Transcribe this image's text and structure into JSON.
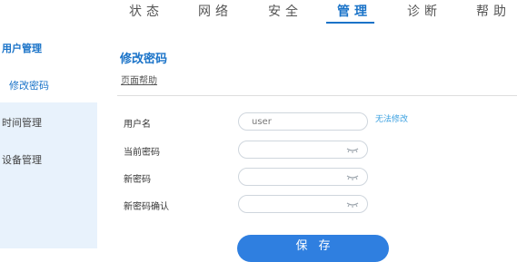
{
  "nav": {
    "tabs": [
      {
        "label": "状态"
      },
      {
        "label": "网络"
      },
      {
        "label": "安全"
      },
      {
        "label": "管理",
        "active": true
      },
      {
        "label": "诊断"
      },
      {
        "label": "帮助"
      }
    ]
  },
  "sidebar": {
    "items": [
      {
        "label": "用户管理",
        "active": true
      },
      {
        "label": "修改密码",
        "active": true
      },
      {
        "label": "时间管理"
      },
      {
        "label": "设备管理"
      }
    ]
  },
  "main": {
    "title": "修改密码",
    "help_link": "页面帮助",
    "form": {
      "username_label": "用户名",
      "username_value": "user",
      "username_note": "无法修改",
      "current_password_label": "当前密码",
      "new_password_label": "新密码",
      "confirm_password_label": "新密码确认",
      "save_label": "保存"
    }
  },
  "colors": {
    "accent": "#1a73c8",
    "button": "#2f7fe0",
    "sidebar_bg": "#e8f2fc",
    "note": "#3aa0e0"
  },
  "icons": {
    "password_toggle": "eye-closed-icon"
  }
}
